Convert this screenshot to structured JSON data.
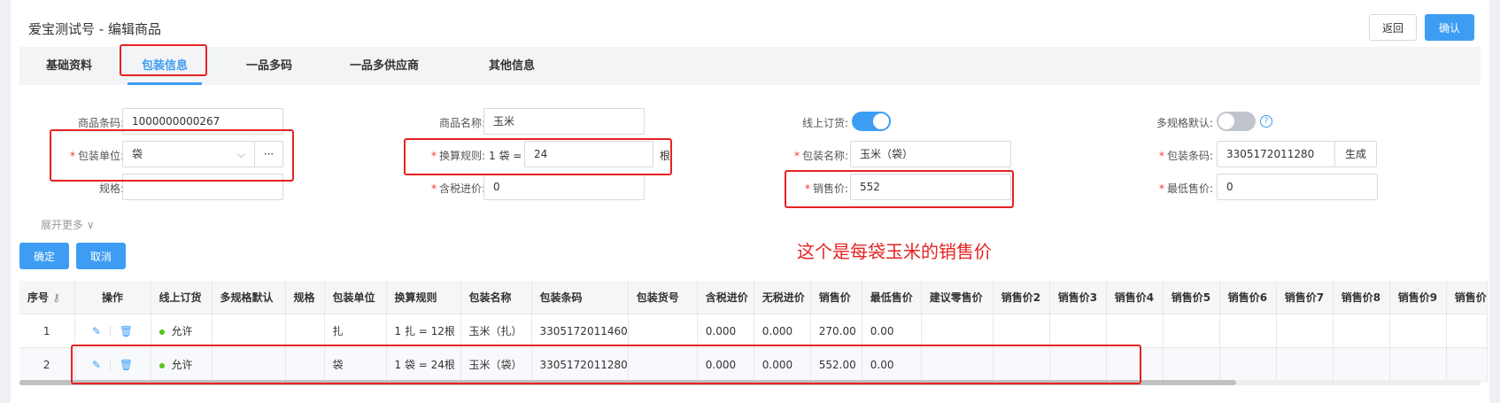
{
  "header": {
    "title": "爱宝测试号 - 编辑商品",
    "back_label": "返回",
    "confirm_label": "确认"
  },
  "tabs": [
    "基础资料",
    "包装信息",
    "一品多码",
    "一品多供应商",
    "其他信息"
  ],
  "form": {
    "barcode_label": "商品条码:",
    "barcode_value": "1000000000267",
    "unit_label": "包装单位:",
    "unit_value": "袋",
    "unit_more": "···",
    "spec_label": "规格:",
    "name_label": "商品名称:",
    "name_value": "玉米",
    "conversion_label": "换算规则:",
    "conversion_prefix": "1 袋 =",
    "conversion_value": "24",
    "conversion_suffix": "根",
    "tax_price_label": "含税进价:",
    "tax_price_value": "0",
    "online_order_label": "线上订货:",
    "pack_name_label": "包装名称:",
    "pack_name_value": "玉米（袋）",
    "sale_price_label": "销售价:",
    "sale_price_value": "552",
    "multi_spec_label": "多规格默认:",
    "help_glyph": "?",
    "pack_barcode_label": "包装条码:",
    "pack_barcode_value": "3305172011280",
    "generate_label": "生成",
    "min_price_label": "最低售价:",
    "min_price_value": "0",
    "expand_label": "展开更多 ∨",
    "ok_label": "确定",
    "cancel_label": "取消"
  },
  "annotation": "这个是每袋玉米的销售价",
  "table": {
    "columns": [
      "序号",
      "操作",
      "线上订货",
      "多规格默认",
      "规格",
      "包装单位",
      "换算规则",
      "包装名称",
      "包装条码",
      "包装货号",
      "含税进价",
      "无税进价",
      "销售价",
      "最低售价",
      "建议零售价",
      "销售价2",
      "销售价3",
      "销售价4",
      "销售价5",
      "销售价6",
      "销售价7",
      "销售价8",
      "销售价9",
      "销售价"
    ],
    "rows": [
      [
        "1",
        "",
        "允许",
        "",
        "",
        "扎",
        "1 扎 = 12根",
        "玉米（扎）",
        "3305172011460",
        "",
        "0.000",
        "0.000",
        "270.00",
        "0.00",
        "",
        "",
        "",
        "",
        "",
        "",
        "",
        "",
        "",
        ""
      ],
      [
        "2",
        "",
        "允许",
        "",
        "",
        "袋",
        "1 袋 = 24根",
        "玉米（袋）",
        "3305172011280",
        "",
        "0.000",
        "0.000",
        "552.00",
        "0.00",
        "",
        "",
        "",
        "",
        "",
        "",
        "",
        "",
        "",
        ""
      ]
    ]
  },
  "colors": {
    "primary": "#3d9df3",
    "annotation_red": "#e62222",
    "status_green": "#52c41a"
  }
}
